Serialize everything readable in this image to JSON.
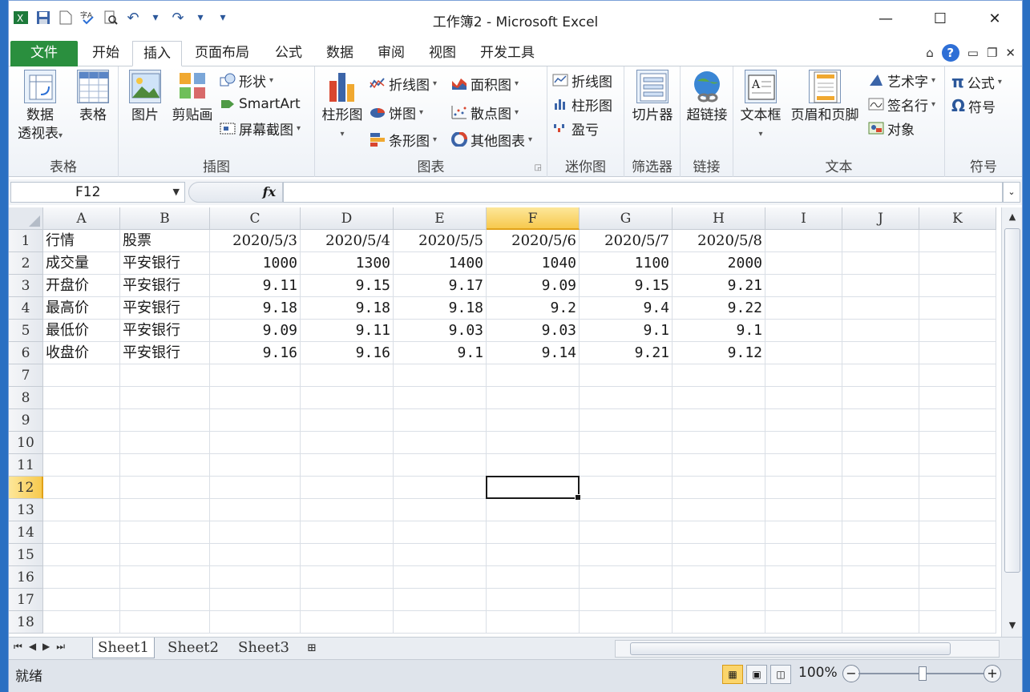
{
  "window": {
    "title": "工作簿2 - Microsoft Excel",
    "controls": {
      "minimize": "—",
      "maximize": "☐",
      "close": "✕"
    }
  },
  "qat": {
    "undo": "↶",
    "redo": "↷"
  },
  "tabs": [
    {
      "label": "文件",
      "kind": "file"
    },
    {
      "label": "开始"
    },
    {
      "label": "插入",
      "active": true
    },
    {
      "label": "页面布局"
    },
    {
      "label": "公式"
    },
    {
      "label": "数据"
    },
    {
      "label": "审阅"
    },
    {
      "label": "视图"
    },
    {
      "label": "开发工具"
    }
  ],
  "ribbon": {
    "tables": {
      "label": "表格",
      "pivot_line1": "数据",
      "pivot_line2": "透视表",
      "table": "表格"
    },
    "illustrations": {
      "label": "插图",
      "picture": "图片",
      "clipart": "剪贴画",
      "shapes": "形状",
      "smartart": "SmartArt",
      "screenshot": "屏幕截图"
    },
    "charts": {
      "label": "图表",
      "column": "柱形图",
      "line": "折线图",
      "pie": "饼图",
      "bar": "条形图",
      "area": "面积图",
      "scatter": "散点图",
      "other": "其他图表"
    },
    "sparklines": {
      "label": "迷你图",
      "line": "折线图",
      "column": "柱形图",
      "winloss": "盈亏"
    },
    "filter": {
      "label": "筛选器",
      "slicer": "切片器"
    },
    "links": {
      "label": "链接",
      "hyperlink": "超链接"
    },
    "text": {
      "label": "文本",
      "textbox": "文本框",
      "headerfooter": "页眉和页脚",
      "wordart": "艺术字",
      "signature": "签名行",
      "object": "对象"
    },
    "symbols": {
      "label": "符号",
      "equation": "公式",
      "symbol": "符号",
      "pi": "π",
      "omega": "Ω"
    }
  },
  "formula_bar": {
    "name_box": "F12",
    "fx": "fx",
    "formula": ""
  },
  "sheet": {
    "columns": [
      "A",
      "B",
      "C",
      "D",
      "E",
      "F",
      "G",
      "H",
      "I",
      "J",
      "K"
    ],
    "selected_column": "F",
    "rows": [
      "1",
      "2",
      "3",
      "4",
      "5",
      "6",
      "7",
      "8",
      "9",
      "10",
      "11",
      "12",
      "13",
      "14",
      "15",
      "16",
      "17",
      "18"
    ],
    "selected_row": "12",
    "data": [
      [
        "行情",
        "股票",
        "2020/5/3",
        "2020/5/4",
        "2020/5/5",
        "2020/5/6",
        "2020/5/7",
        "2020/5/8"
      ],
      [
        "成交量",
        "平安银行",
        "1000",
        "1300",
        "1400",
        "1040",
        "1100",
        "2000"
      ],
      [
        "开盘价",
        "平安银行",
        "9.11",
        "9.15",
        "9.17",
        "9.09",
        "9.15",
        "9.21"
      ],
      [
        "最高价",
        "平安银行",
        "9.18",
        "9.18",
        "9.18",
        "9.2",
        "9.4",
        "9.22"
      ],
      [
        "最低价",
        "平安银行",
        "9.09",
        "9.11",
        "9.03",
        "9.03",
        "9.1",
        "9.1"
      ],
      [
        "收盘价",
        "平安银行",
        "9.16",
        "9.16",
        "9.1",
        "9.14",
        "9.21",
        "9.12"
      ]
    ]
  },
  "sheet_tabs": [
    "Sheet1",
    "Sheet2",
    "Sheet3"
  ],
  "active_sheet": "Sheet1",
  "status": {
    "ready": "就绪",
    "zoom": "100%",
    "minus": "−",
    "plus": "+"
  },
  "colors": {
    "file_tab": "#2a8f3e",
    "selection": "#f7c94e",
    "accent": "#2b579a"
  }
}
